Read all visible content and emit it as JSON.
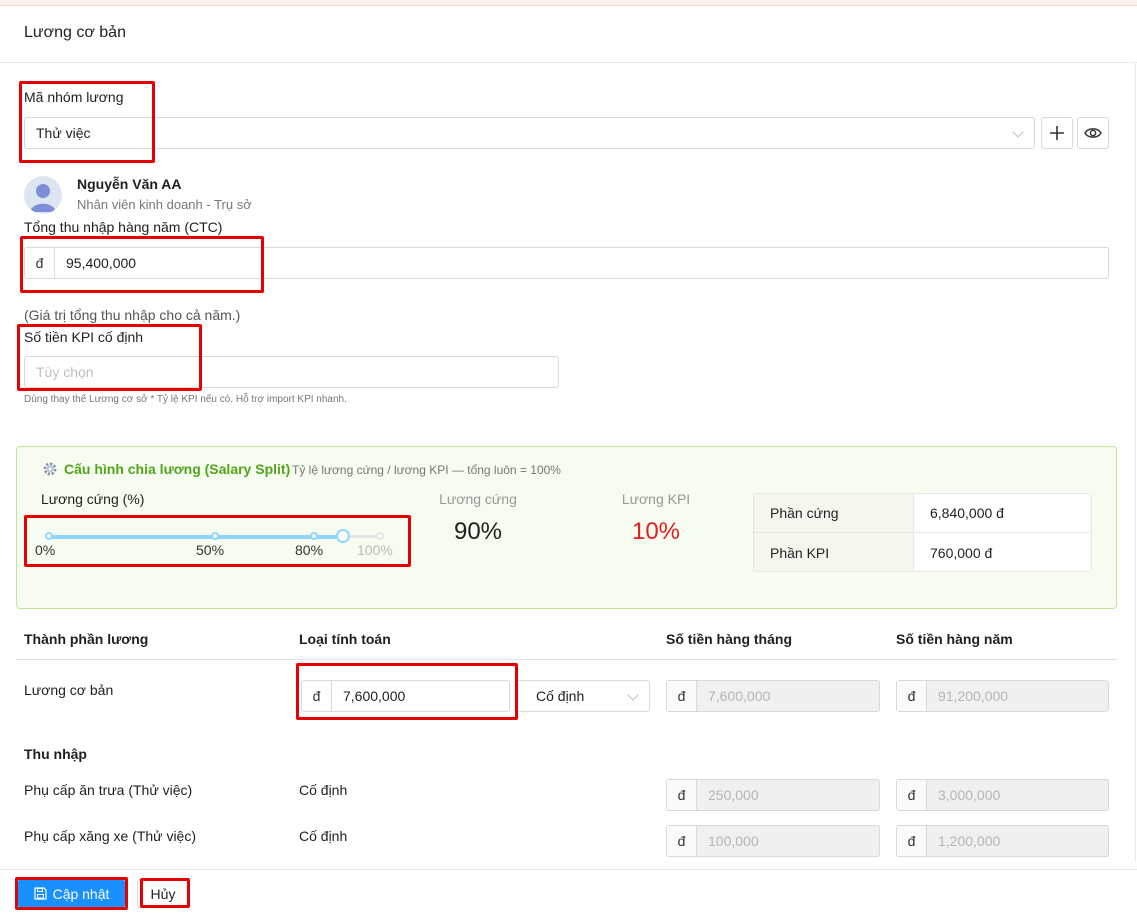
{
  "page": {
    "title": "Lương cơ bản"
  },
  "salary_group": {
    "label": "Mã nhóm lương",
    "value": "Thử việc",
    "add_icon": "plus-icon",
    "view_icon": "eye-icon"
  },
  "employee": {
    "name": "Nguyễn Văn AA",
    "role": "Nhân viên kinh doanh - Trụ sở"
  },
  "ctc": {
    "label": "Tổng thu nhập hàng năm (CTC)",
    "prefix": "đ",
    "value": "95,400,000",
    "help": "(Giá trị tổng thu nhập cho cả năm.)"
  },
  "kpi": {
    "label": "Số tiền KPI cố định",
    "placeholder": "Tùy chọn",
    "help": "Dùng thay thế Lương cơ sở * Tỷ lệ KPI nếu có. Hỗ trợ import KPI nhanh."
  },
  "split": {
    "icon": "gear-icon",
    "title": "Cấu hình chia lương (Salary Split)",
    "subtitle": "Tỷ lệ lương cứng / lương KPI — tổng luôn = 100%",
    "slider_label": "Lương cứng (%)",
    "slider_value_percent": 90,
    "marks": [
      "0%",
      "50%",
      "80%",
      "100%"
    ],
    "fixed_label": "Lương cứng",
    "fixed_value": "90%",
    "kpi_label": "Lương KPI",
    "kpi_value": "10%",
    "kpi_color": "#e02020",
    "rows": [
      {
        "k": "Phần cứng",
        "v": "6,840,000 đ"
      },
      {
        "k": "Phần KPI",
        "v": "760,000 đ"
      }
    ]
  },
  "table": {
    "headers": [
      "Thành phần lương",
      "Loại tính toán",
      "Số tiền hàng tháng",
      "Số tiền hàng năm"
    ],
    "base": {
      "name": "Lương cơ bản",
      "prefix": "đ",
      "amount": "7,600,000",
      "calc_type": "Cố định",
      "monthly": "7,600,000",
      "yearly": "91,200,000"
    },
    "income_heading": "Thu nhập",
    "income_rows": [
      {
        "name": "Phụ cấp ăn trưa (Thử việc)",
        "calc": "Cố định",
        "monthly": "250,000",
        "yearly": "3,000,000"
      },
      {
        "name": "Phụ cấp xăng xe (Thử việc)",
        "calc": "Cố định",
        "monthly": "100,000",
        "yearly": "1,200,000"
      }
    ]
  },
  "footer": {
    "update_label": "Cập nhật",
    "update_icon": "save-icon",
    "cancel_label": "Hủy"
  },
  "colors": {
    "primary": "#1890ff",
    "highlight": "#e60000",
    "success": "#52a51a"
  }
}
